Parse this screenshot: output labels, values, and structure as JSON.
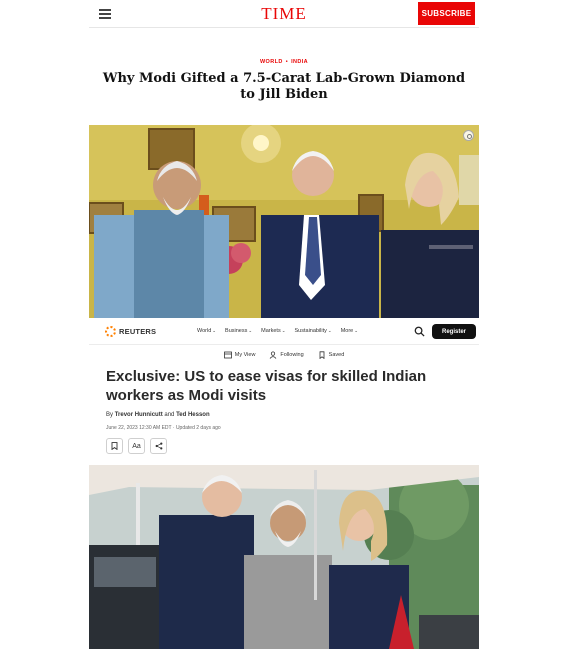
{
  "time": {
    "logo": "TIME",
    "subscribe_label": "SUBSCRIBE",
    "kicker_section": "WORLD",
    "kicker_separator": "•",
    "kicker_topic": "INDIA",
    "headline": "Why Modi Gifted a 7.5-Carat Lab-Grown Diamond to Jill Biden"
  },
  "reuters": {
    "logo": "REUTERS",
    "menu": [
      "World",
      "Business",
      "Markets",
      "Sustainability",
      "More"
    ],
    "register_label": "Register",
    "sub_nav": [
      "My View",
      "Following",
      "Saved"
    ],
    "headline": "Exclusive: US to ease visas for skilled Indian workers as Modi visits",
    "byline_prefix": "By",
    "author1": "Trevor Hunnicutt",
    "byline_and": "and",
    "author2": "Ted Hesson",
    "date": "June 22, 2023 12:30 AM EDT · Updated 2 days ago",
    "text_size_label": "Aa"
  },
  "colors": {
    "time_red": "#e90606",
    "reuters_orange": "#ff8000"
  }
}
